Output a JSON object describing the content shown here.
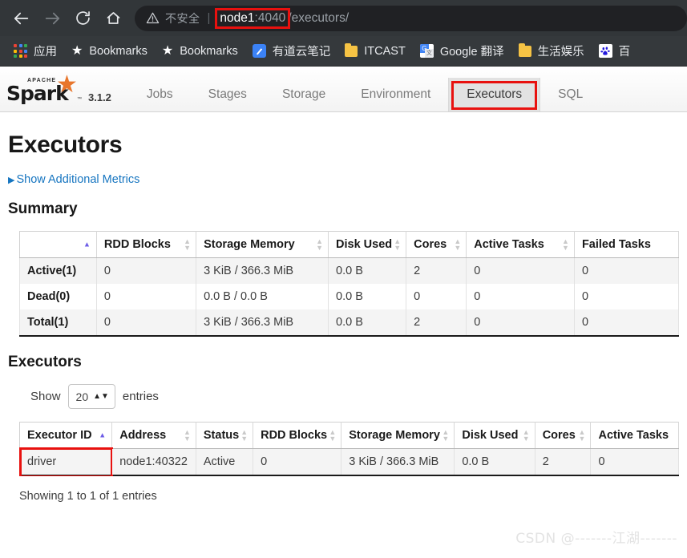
{
  "browser": {
    "nav": {
      "back": "back-arrow",
      "forward": "forward-arrow",
      "reload": "reload",
      "home": "home"
    },
    "omnibox": {
      "security_icon": "warning-triangle",
      "security_label": "不安全",
      "divider": "|",
      "url_host": "node1",
      "url_port": ":4040",
      "url_path": "/executors/",
      "full_url": "node1:4040/executors/"
    },
    "bookmarks": [
      {
        "label": "应用",
        "icon": "apps-grid-icon"
      },
      {
        "label": "Bookmarks",
        "icon": "star-icon"
      },
      {
        "label": "Bookmarks",
        "icon": "star-icon"
      },
      {
        "label": "有道云笔记",
        "icon": "youdao-icon"
      },
      {
        "label": "ITCAST",
        "icon": "folder-icon"
      },
      {
        "label": "Google 翻译",
        "icon": "google-translate-icon"
      },
      {
        "label": "生活娱乐",
        "icon": "folder-icon"
      },
      {
        "label": "百",
        "icon": "baidu-icon"
      }
    ]
  },
  "spark": {
    "logo": {
      "apache": "APACHE",
      "name": "Spark",
      "tm": "TM"
    },
    "version": "3.1.2",
    "tabs": [
      {
        "label": "Jobs",
        "active": false
      },
      {
        "label": "Stages",
        "active": false
      },
      {
        "label": "Storage",
        "active": false
      },
      {
        "label": "Environment",
        "active": false
      },
      {
        "label": "Executors",
        "active": true
      },
      {
        "label": "SQL",
        "active": false
      }
    ],
    "page_title": "Executors",
    "additional_metrics_link": "Show Additional Metrics",
    "summary": {
      "title": "Summary",
      "columns": [
        "",
        "RDD Blocks",
        "Storage Memory",
        "Disk Used",
        "Cores",
        "Active Tasks",
        "Failed Tasks"
      ],
      "sorted_column_index": 0,
      "rows": [
        {
          "cells": [
            "Active(1)",
            "0",
            "3 KiB / 366.3 MiB",
            "0.0 B",
            "2",
            "0",
            "0"
          ]
        },
        {
          "cells": [
            "Dead(0)",
            "0",
            "0.0 B / 0.0 B",
            "0.0 B",
            "0",
            "0",
            "0"
          ]
        },
        {
          "cells": [
            "Total(1)",
            "0",
            "3 KiB / 366.3 MiB",
            "0.0 B",
            "2",
            "0",
            "0"
          ]
        }
      ]
    },
    "executors": {
      "title": "Executors",
      "length_show": "Show",
      "length_value": "20",
      "length_entries": "entries",
      "columns": [
        "Executor ID",
        "Address",
        "Status",
        "RDD Blocks",
        "Storage Memory",
        "Disk Used",
        "Cores",
        "Active Tasks"
      ],
      "sorted_column_index": 0,
      "rows": [
        {
          "cells": [
            "driver",
            "node1:40322",
            "Active",
            "0",
            "3 KiB / 366.3 MiB",
            "0.0 B",
            "2",
            "0"
          ]
        }
      ],
      "showing_info": "Showing 1 to 1 of 1 entries"
    }
  },
  "watermark": "CSDN @-------江湖-------",
  "colors": {
    "accent_orange": "#e8762c",
    "link_blue": "#1675c0",
    "annotation_red": "#e8110f",
    "chrome_dark": "#323639"
  }
}
